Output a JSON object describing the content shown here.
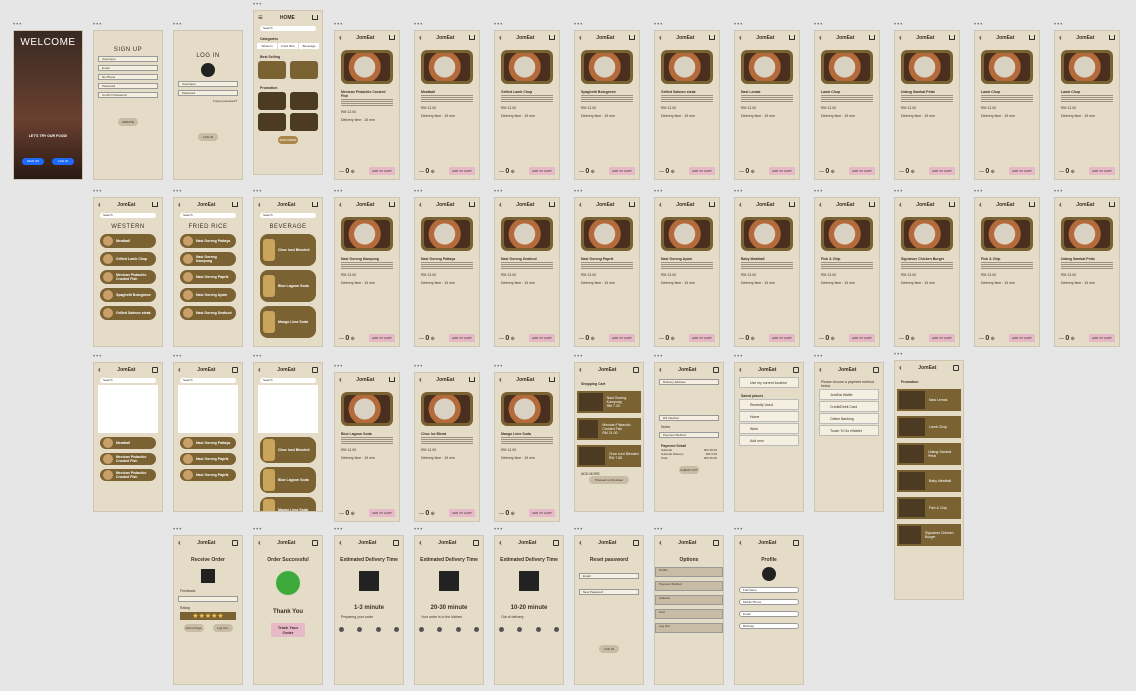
{
  "app": "JomEat",
  "ui": {
    "add_to_cart": "ADD TO CART",
    "qty": "0",
    "delivery": "Delivery time : 15 min",
    "price": "RM 12.00"
  },
  "welcome": {
    "title": "WELCOME",
    "tag": "LET'S TRY OUR FOOD!",
    "signup": "SIGN UP",
    "login": "LOG IN"
  },
  "signup": {
    "title": "SIGN UP",
    "fields": [
      "Username",
      "Email",
      "No Phone",
      "Password",
      "Confirm Password"
    ],
    "button": "CREATE"
  },
  "login": {
    "title": "LOG IN",
    "fields": [
      "Username",
      "Password"
    ],
    "forgot": "Forgot password?",
    "button": "LOG IN"
  },
  "home": {
    "title": "HOME",
    "search": "Search",
    "categories_label": "Categories",
    "categories": [
      "Western",
      "Fried Rice",
      "Beverage"
    ],
    "best_selling": "Best Selling",
    "promotion": "Promotion",
    "find_more": "FIND MORE"
  },
  "row1_dishes": [
    "Mexican Pistachio Crusted Fish",
    "Meatball",
    "Grilled Lamb Chop",
    "Spaghetti Bolognese",
    "Grilled Salmon steak",
    "Nasi Lemak",
    "Lamb Chop",
    "Udang Sambal Petai",
    "Lamb Chop",
    "Lamb Chop"
  ],
  "row2_dishes": [
    "Nasi Goreng Kampung",
    "Nasi Goreng Pattaya",
    "Nasi Goreng Seafood",
    "Nasi Goreng Paprik",
    "Nasi Goreng Ayam",
    "Baby Meatball",
    "Fish & Chip",
    "Signature Chicken Burger",
    "Fish & Chip",
    "Udang Sambal Petai"
  ],
  "row3_dishes": [
    "Blue Lagoon Soda",
    "Choc Ice Blend",
    "Mango Lime Soda"
  ],
  "menus": {
    "western": {
      "title": "WESTERN",
      "items": [
        "Meatball",
        "Grilled Lamb Chop",
        "Mexican Pistachio Crusted Fish",
        "Spaghetti Bolognese",
        "Grilled Salmon steak"
      ]
    },
    "friedrice": {
      "title": "FRIED RICE",
      "items": [
        "Nasi Goreng Pattaya",
        "Nasi Goreng Kampung",
        "Nasi Goreng Paprik",
        "Nasi Goreng Ayam",
        "Nasi Goreng Seafood"
      ]
    },
    "beverage": {
      "title": "BEVERAGE",
      "items": [
        "Choc Iced Blended",
        "Blue Lagoon Soda",
        "Mango Lime Soda"
      ]
    }
  },
  "cart": {
    "title": "Shopping Cart",
    "items": [
      {
        "name": "Nasi Goreng Kampung",
        "price": "RM 7.20"
      },
      {
        "name": "Mexican Pistachio Crusted Fish",
        "price": "RM 21.00"
      },
      {
        "name": "Choc Iced Blended",
        "price": "RM 7.80"
      }
    ],
    "add_more": "ADD MORE",
    "checkout": "Proceed to Checkout"
  },
  "checkout": {
    "address": "Delivery Address",
    "voucher": "DS Voucher",
    "code": "CODE",
    "notes": "Notes",
    "payment": "Payment Method",
    "detail": "Payment Detail",
    "subtotal_label": "Subtotal",
    "subtotal": "RM 36.00",
    "delivery_label": "Subtotal Delivery",
    "delivery": "RM 3.00",
    "total_label": "Total",
    "total": "RM 39.00",
    "button": "CHECK OUT"
  },
  "address": {
    "use_location": "Use my current location",
    "saved": "Saved places",
    "options": [
      "Recently Used",
      "Home",
      "Work",
      "Add new"
    ]
  },
  "pay": {
    "label": "Please choose a payment method below",
    "options": [
      "JomEat Wallet",
      "Credit/Debit Card",
      "Online Banking",
      "Touch 'N Go eWallet"
    ]
  },
  "promo": {
    "title": "Promotion",
    "items": [
      "Nasi Lemak",
      "Lamb Chop",
      "Udang Sambal Petai",
      "Baby Meatball",
      "Fish & Chip",
      "Signature Chicken Burger"
    ]
  },
  "receive": {
    "title": "Receive Order",
    "feedback": "Feedback",
    "rating": "Rating",
    "stars": "★★★★★",
    "home": "Home Page",
    "logout": "Log Out"
  },
  "success": {
    "title": "Order Successful",
    "thanks": "Thank You",
    "track": "Track Your Order"
  },
  "track": [
    {
      "title": "Estimated Delivery Time",
      "eta": "1-3 minute",
      "status": "Preparing your order"
    },
    {
      "title": "Estimated Delivery Time",
      "eta": "20-30 minute",
      "status": "Your order is in the kitchen"
    },
    {
      "title": "Estimated Delivery Time",
      "eta": "10-20 minute",
      "status": "Out of delivery"
    }
  ],
  "reset": {
    "title": "Reset password",
    "fields": [
      "Email",
      "New Password"
    ],
    "button": "LOG IN"
  },
  "options": {
    "title": "Options",
    "items": [
      "Profile",
      "Payment Method",
      "Address",
      "Cart",
      "Log Out"
    ]
  },
  "profile": {
    "title": "Profile",
    "fields": [
      "Full Name",
      "Mobile Phone",
      "Email",
      "Birthday"
    ]
  },
  "colors": {
    "bg": "#e6e6e6",
    "frame": "#e5dcc8",
    "brown": "#7a6233",
    "pink": "#e7b9c8"
  }
}
